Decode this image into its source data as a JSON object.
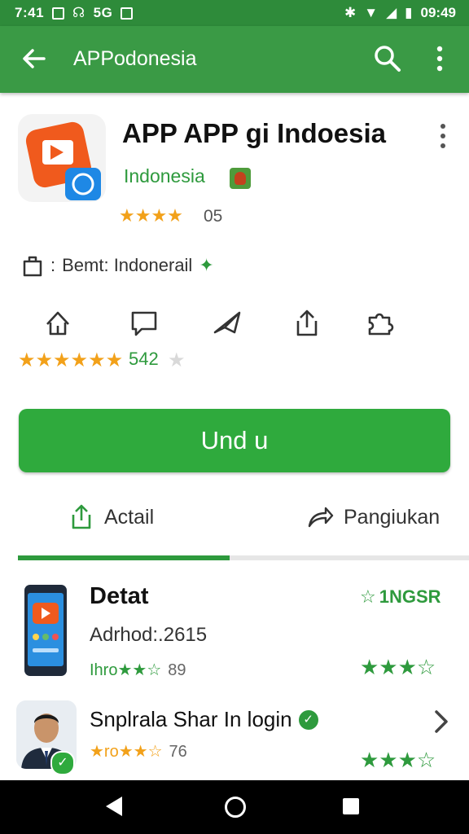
{
  "status_bar": {
    "time": "7:41",
    "left_icons": [
      "notification-icon",
      "headset-icon",
      "signal-icon",
      "download-icon"
    ],
    "left_text": "5G",
    "clock_right": "09:49"
  },
  "toolbar": {
    "title": "APPodonesia"
  },
  "app": {
    "title": "APP  APP   gi Indoesia",
    "developer": "Indonesia",
    "rating_stars": "★★★★",
    "rating_count": "05",
    "info": "Bemt: Indonerail",
    "info_prefix": ":",
    "big_stars": "★★★★★★",
    "big_count": "542",
    "faint_star": "★"
  },
  "actions": [
    "home-outline-icon",
    "comment-icon",
    "share-plane-icon",
    "upload-icon",
    "puzzle-icon"
  ],
  "install_button": {
    "label": "Und u"
  },
  "tabs": [
    {
      "label": "Actail",
      "icon": "upload-icon"
    },
    {
      "label": "Pangiukan",
      "icon": "share-arrow-icon"
    }
  ],
  "active_tab_fraction": 0.47,
  "list": {
    "item1": {
      "title": "Detat",
      "subtitle": "Adrhod:.2615",
      "meta_stars": "Ihro★★☆",
      "meta_count": "89",
      "tag": "1NGSR",
      "right_stars": "★★★☆"
    },
    "item2": {
      "title": "Snplrala Shar In login",
      "meta_stars": "★ro★★☆",
      "meta_count": "76",
      "right_stars": "★★★☆"
    }
  },
  "colors": {
    "primary": "#3a9a45",
    "status": "#2e8b3a",
    "button": "#2faa3d",
    "star": "#f2a11a"
  }
}
